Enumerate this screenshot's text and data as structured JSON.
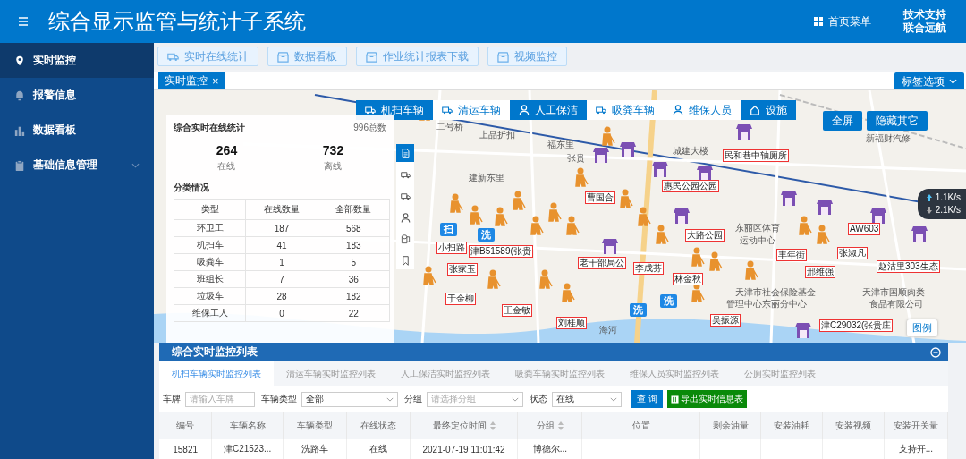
{
  "header": {
    "title": "综合显示监管与统计子系统",
    "menu_link": "首页菜单",
    "support": [
      "技术支持",
      "联合远航"
    ]
  },
  "sidebar": {
    "items": [
      {
        "label": "实时监控",
        "kind": "pin",
        "selected": true
      },
      {
        "label": "报警信息",
        "kind": "alarm",
        "selected": false
      },
      {
        "label": "数据看板",
        "kind": "chart",
        "selected": false
      },
      {
        "label": "基础信息管理",
        "kind": "clipboard",
        "selected": false,
        "expanded": false
      }
    ]
  },
  "toolbar": {
    "buttons": [
      {
        "label": "实时在线统计",
        "kind": "truck"
      },
      {
        "label": "数据看板",
        "kind": "box"
      },
      {
        "label": "作业统计报表下载",
        "kind": "box"
      },
      {
        "label": "视频监控",
        "kind": "box"
      }
    ]
  },
  "open_tabs": [
    {
      "label": "实时监控",
      "close": "×",
      "selected": true
    }
  ],
  "tab_options": "标签选项",
  "map": {
    "categories": [
      {
        "label": "机扫车辆",
        "kind": "truck",
        "selected": true
      },
      {
        "label": "清运车辆",
        "kind": "truck",
        "selected": false
      },
      {
        "label": "人工保洁",
        "kind": "person",
        "selected": true
      },
      {
        "label": "吸粪车辆",
        "kind": "truck",
        "selected": false
      },
      {
        "label": "维保人员",
        "kind": "person",
        "selected": false
      },
      {
        "label": "设施",
        "kind": "home",
        "selected": true
      }
    ],
    "actions": [
      "全屏",
      "隐藏其它"
    ],
    "layer_tools": [
      {
        "kind": "document",
        "selected": true
      },
      {
        "kind": "truck",
        "selected": false
      },
      {
        "kind": "truck",
        "selected": false
      },
      {
        "kind": "person",
        "selected": false
      },
      {
        "kind": "paper",
        "selected": false
      },
      {
        "kind": "bookmark",
        "selected": false
      }
    ],
    "places": [
      "二号桥",
      "上品折扣",
      "福东里",
      "张贵",
      "建新东里",
      "城建大楼",
      "新福财汽修",
      "东丽区体育",
      "运动中心",
      "天津市社会保险基金",
      "管理中心东丽分中心",
      "天津市国顺肉类",
      "食品有限公司",
      "海河"
    ],
    "markers": [
      "民和巷中轴厕所",
      "惠民公园公园",
      "曹国合",
      "大路公园",
      "AW603",
      "小扫路",
      "津B51589(张贵",
      "丰年街",
      "张淑凡",
      "张家玉",
      "老干部局公",
      "李成芬",
      "邢维强",
      "赵沽里303生态",
      "林金秋",
      "于金柳",
      "王金敏",
      "刘桂顺",
      "吴振源",
      "津C29032(张贵庄"
    ],
    "vehicles": [
      "扫",
      "洗",
      "洗",
      "洗"
    ],
    "legend": "图例",
    "speeds": [
      "1.1K/s",
      "2.1K/s"
    ]
  },
  "stats": {
    "title": "综合实时在线统计",
    "total": "996总数",
    "online": {
      "value": "264",
      "label": "在线"
    },
    "offline": {
      "value": "732",
      "label": "离线"
    },
    "section": "分类情况",
    "columns": [
      "类型",
      "在线数量",
      "全部数量"
    ],
    "rows": [
      [
        "环卫工",
        "187",
        "568"
      ],
      [
        "机扫车",
        "41",
        "183"
      ],
      [
        "吸粪车",
        "1",
        "5"
      ],
      [
        "班组长",
        "7",
        "36"
      ],
      [
        "垃圾车",
        "28",
        "182"
      ],
      [
        "维保工人",
        "0",
        "22"
      ]
    ]
  },
  "monitor": {
    "title": "综合实时监控列表",
    "tabs": [
      {
        "label": "机扫车辆实时监控列表",
        "selected": true
      },
      {
        "label": "清运车辆实时监控列表",
        "selected": false
      },
      {
        "label": "人工保洁实时监控列表",
        "selected": false
      },
      {
        "label": "吸粪车辆实时监控列表",
        "selected": false
      },
      {
        "label": "维保人员实时监控列表",
        "selected": false
      },
      {
        "label": "公厕实时监控列表",
        "selected": false
      }
    ],
    "filters": [
      {
        "label": "车牌",
        "kind": "input",
        "placeholder": "请输入车牌"
      },
      {
        "label": "车辆类型",
        "kind": "select",
        "value": "全部"
      },
      {
        "label": "分组",
        "kind": "select",
        "placeholder": "请选择分组"
      },
      {
        "label": "状态",
        "kind": "select",
        "value": "在线"
      }
    ],
    "query_button": "查 询",
    "export_button": "导出实时信息表",
    "columns": [
      {
        "label": "编号",
        "sortable": false
      },
      {
        "label": "车辆名称",
        "sortable": false
      },
      {
        "label": "车辆类型",
        "sortable": false
      },
      {
        "label": "在线状态",
        "sortable": false
      },
      {
        "label": "最终定位时间",
        "sortable": true
      },
      {
        "label": "分组",
        "sortable": true
      },
      {
        "label": "位置",
        "sortable": false
      },
      {
        "label": "剩余油量",
        "sortable": false
      },
      {
        "label": "安装油耗",
        "sortable": false
      },
      {
        "label": "安装视频",
        "sortable": false
      },
      {
        "label": "安装开关量",
        "sortable": false
      }
    ],
    "rows": [
      [
        "15821",
        "津C21523...",
        "洗路车",
        "在线",
        "2021-07-19 11:01:42",
        "博德尔...",
        "",
        "",
        "",
        "",
        "支持开..."
      ]
    ]
  }
}
